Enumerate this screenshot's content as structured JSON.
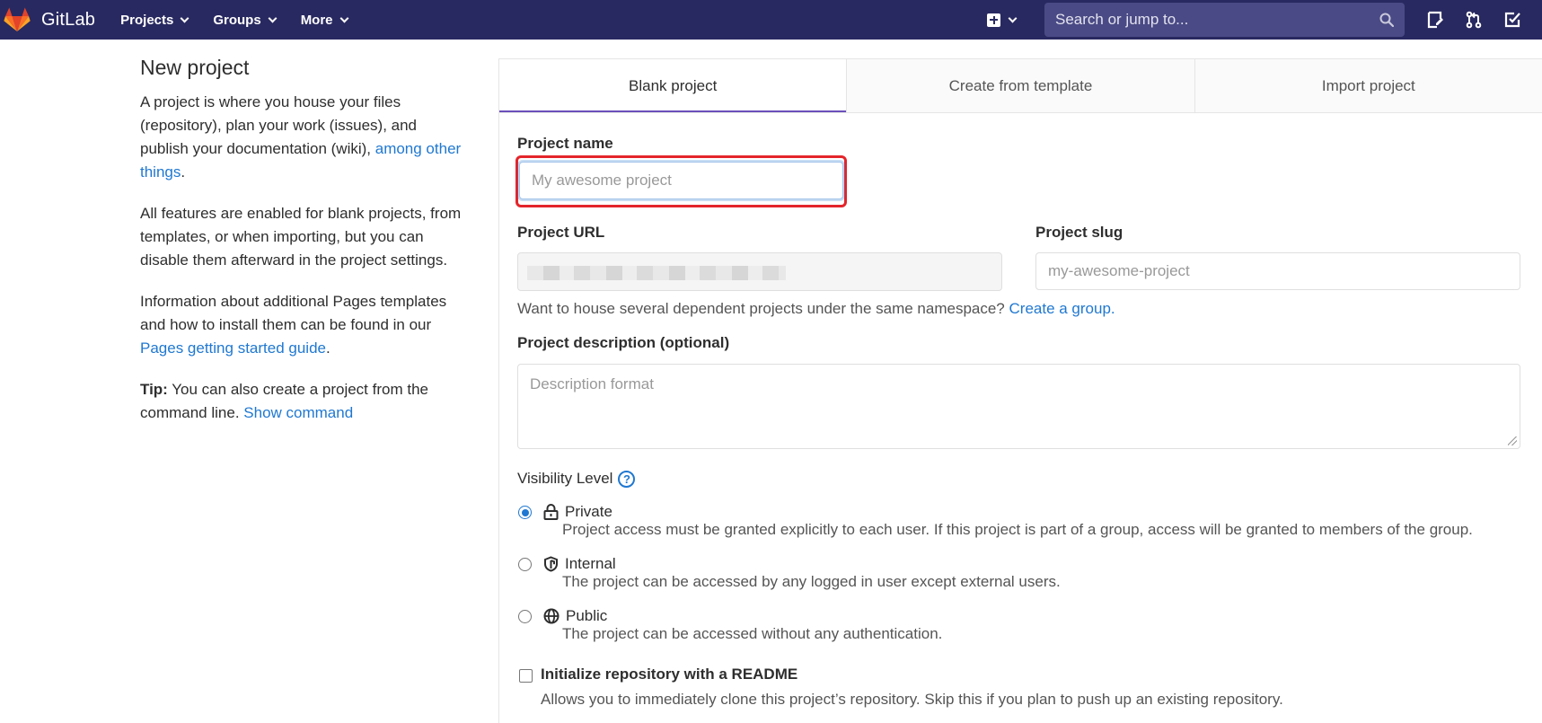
{
  "navbar": {
    "brand": "GitLab",
    "items": [
      {
        "label": "Projects",
        "icon": "chevron-down-icon"
      },
      {
        "label": "Groups",
        "icon": "chevron-down-icon"
      },
      {
        "label": "More",
        "icon": "chevron-down-icon"
      }
    ],
    "search_placeholder": "Search or jump to...",
    "colors": {
      "background": "#292961",
      "search": "#4a4a86"
    }
  },
  "sidebar": {
    "title": "New project",
    "p1_text": "A project is where you house your files (repository), plan your work (issues), and publish your documentation (wiki), ",
    "p1_link": "among other things",
    "p1_end": ".",
    "p2_text": "All features are enabled for blank projects, from templates, or when importing, but you can disable them afterward in the project settings.",
    "p3_text": "Information about additional Pages templates and how to install them can be found in our ",
    "p3_link": "Pages getting started guide",
    "p3_end": ".",
    "tip_bold": "Tip:",
    "tip_text": " You can also create a project from the command line. ",
    "tip_link": "Show command"
  },
  "tabs": [
    {
      "label": "Blank project",
      "active": true
    },
    {
      "label": "Create from template",
      "active": false
    },
    {
      "label": "Import project",
      "active": false
    }
  ],
  "form": {
    "project_name_label": "Project name",
    "project_name_placeholder": "My awesome project",
    "project_url_label": "Project URL",
    "project_slug_label": "Project slug",
    "project_slug_placeholder": "my-awesome-project",
    "namespace_help": "Want to house several dependent projects under the same namespace? ",
    "namespace_link": "Create a group.",
    "description_label": "Project description (optional)",
    "description_placeholder": "Description format",
    "visibility_label": "Visibility Level",
    "visibility_options": [
      {
        "title": "Private",
        "icon": "lock-icon",
        "checked": true,
        "desc": "Project access must be granted explicitly to each user. If this project is part of a group, access will be granted to members of the group."
      },
      {
        "title": "Internal",
        "icon": "shield-icon",
        "checked": false,
        "desc": "The project can be accessed by any logged in user except external users."
      },
      {
        "title": "Public",
        "icon": "globe-icon",
        "checked": false,
        "desc": "The project can be accessed without any authentication."
      }
    ],
    "readme_label": "Initialize repository with a README",
    "readme_desc": "Allows you to immediately clone this project’s repository. Skip this if you plan to push up an existing repository.",
    "highlight_color": "#e3252b",
    "link_color": "#1f78d1"
  }
}
